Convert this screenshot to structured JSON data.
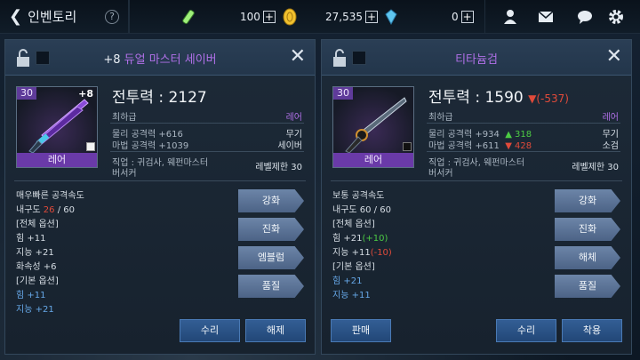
{
  "topbar": {
    "back_label": "인벤토리",
    "help": "?",
    "res1_value": "100",
    "res2_value": "27,535",
    "res3_value": "0",
    "plus": "+"
  },
  "left": {
    "title_enh": "+8",
    "title_name": "듀얼 마스터 세이버",
    "level": "30",
    "plus_badge": "+8",
    "rarity": "레어",
    "power_label": "전투력 : 2127",
    "grade": "최하급",
    "grade_value": "레어",
    "phys_label": "물리 공격력 +616",
    "phys_type": "무기",
    "magic_label": "마법 공격력 +1039",
    "magic_type": "세이버",
    "job_label": "직업 : 귀검사, 웨펀마스터",
    "job_label2": "버서커",
    "level_req": "레벨제한 30",
    "stats": [
      "매우빠른 공격속도",
      "내구도",
      "[전체 옵션]",
      "힘 +11",
      "지능 +21",
      "화속성 +6",
      "[기본 옵션]",
      "힘 +11",
      "지능 +21"
    ],
    "durability_cur": "26",
    "durability_max": " / 60",
    "buttons": {
      "enhance": "강화",
      "evolve": "진화",
      "emblem": "엠블럼",
      "quality": "품질"
    },
    "bottom": {
      "repair": "수리",
      "dismantle": "해제"
    }
  },
  "right": {
    "title_name": "티타늄검",
    "level": "30",
    "rarity": "레어",
    "power_label": "전투력 : 1590",
    "power_diff": "▼(-537)",
    "grade": "최하급",
    "grade_value": "레어",
    "phys_label": "물리 공격력 +934",
    "phys_diff": "▲ 318",
    "phys_type": "무기",
    "magic_label": "마법 공격력 +611",
    "magic_diff": "▼ 428",
    "magic_type": "소검",
    "job_label": "직업 : 귀검사, 웨펀마스터",
    "job_label2": "버서커",
    "level_req": "레벨제한 30",
    "stats": [
      "보통 공격속도",
      "내구도 60 / 60",
      "[전체 옵션]",
      "힘 +21",
      "(+10)",
      "지능 +11",
      "(-10)",
      "[기본 옵션]",
      "힘 +21",
      "지능 +11"
    ],
    "buttons": {
      "enhance": "강화",
      "evolve": "진화",
      "dismantle": "해체",
      "quality": "품질"
    },
    "bottom": {
      "sell": "판매",
      "repair": "수리",
      "equip": "착용"
    }
  },
  "colors": {
    "accent_purple": "#b070e8",
    "up": "#4ccc44",
    "down": "#e04a3a",
    "option_blue": "#66a8e8"
  }
}
